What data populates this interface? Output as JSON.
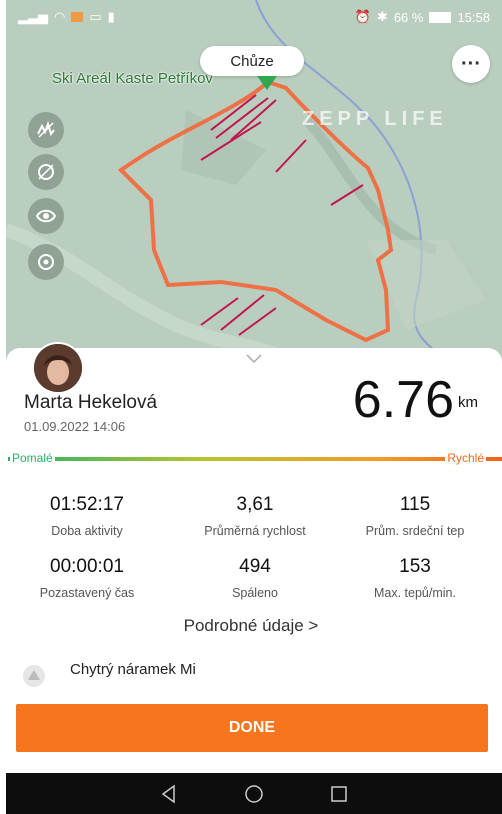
{
  "status_bar": {
    "battery": "66 %",
    "time": "15:58"
  },
  "map": {
    "activity_type": "Chůze",
    "place_label": "Ski Areál Kaste Petříkov",
    "watermark": "ZEPP LIFE",
    "route_color": "#ee7146"
  },
  "user": {
    "name": "Marta Hekelová",
    "date": "01.09.2022 14:06"
  },
  "distance": {
    "value": "6.76",
    "unit": "km"
  },
  "pace_scale": {
    "slow_label": "Pomalé",
    "fast_label": "Rychlé"
  },
  "stats": [
    {
      "value": "01:52:17",
      "label": "Doba aktivity"
    },
    {
      "value": "3,61",
      "label": "Průměrná rychlost"
    },
    {
      "value": "115",
      "label": "Prům. srdeční tep"
    },
    {
      "value": "00:00:01",
      "label": "Pozastavený čas"
    },
    {
      "value": "494",
      "label": "Spáleno"
    },
    {
      "value": "153",
      "label": "Max. tepů/min."
    }
  ],
  "details_link": "Podrobné údaje >",
  "device": {
    "name": "Chytrý náramek Mi"
  },
  "done_label": "DONE",
  "colors": {
    "accent": "#f5761e",
    "map_bg": "#b9cebe"
  }
}
